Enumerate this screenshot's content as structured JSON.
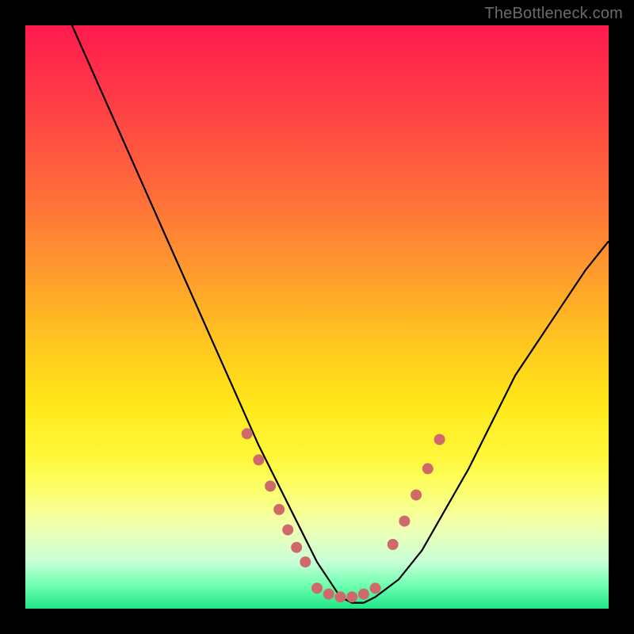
{
  "watermark": "TheBottleneck.com",
  "chart_data": {
    "type": "line",
    "title": "",
    "xlabel": "",
    "ylabel": "",
    "xlim": [
      0,
      100
    ],
    "ylim": [
      0,
      100
    ],
    "grid": false,
    "series": [
      {
        "name": "curve",
        "x": [
          8,
          12,
          16,
          20,
          24,
          28,
          32,
          36,
          40,
          44,
          48,
          50,
          52,
          54,
          56,
          58,
          60,
          64,
          68,
          72,
          76,
          80,
          84,
          88,
          92,
          96,
          100
        ],
        "y": [
          100,
          91,
          82,
          73,
          64,
          55,
          46,
          37,
          28,
          20,
          12,
          8,
          5,
          2,
          1,
          1,
          2,
          5,
          10,
          17,
          24,
          32,
          40,
          46,
          52,
          58,
          63
        ]
      }
    ],
    "markers": [
      {
        "name": "left-descent-dots",
        "color": "#d06a6a",
        "x": [
          38,
          40,
          42,
          43.5,
          45,
          46.5,
          48
        ],
        "y": [
          30,
          25.5,
          21,
          17,
          13.5,
          10.5,
          8
        ]
      },
      {
        "name": "valley-dots",
        "color": "#d06a6a",
        "x": [
          50,
          52,
          54,
          56,
          58,
          60
        ],
        "y": [
          3.5,
          2.5,
          2,
          2,
          2.5,
          3.5
        ]
      },
      {
        "name": "right-ascent-dots",
        "color": "#d06a6a",
        "x": [
          63,
          65,
          67,
          69,
          71
        ],
        "y": [
          11,
          15,
          19.5,
          24,
          29
        ]
      }
    ],
    "colors": {
      "curve_stroke": "#000000",
      "marker_fill": "#d06a6a",
      "top": "#ff1a4d",
      "mid": "#ffe81a",
      "bottom": "#20e688",
      "frame": "#000000"
    }
  }
}
